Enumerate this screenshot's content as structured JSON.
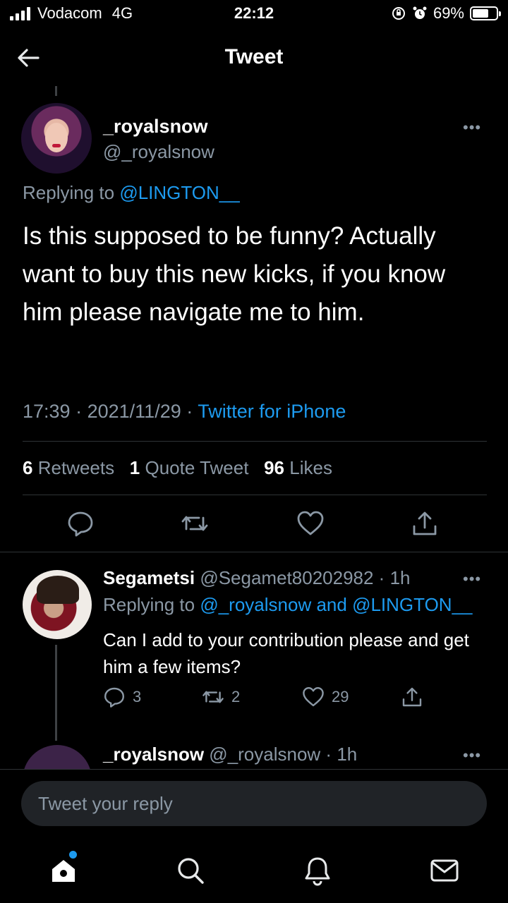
{
  "status_bar": {
    "carrier": "Vodacom",
    "network": "4G",
    "time": "22:12",
    "battery_percent": "69%",
    "battery_level": 0.69
  },
  "header": {
    "title": "Tweet",
    "back_icon": "arrow-left-icon"
  },
  "main_tweet": {
    "display_name": "_royalsnow",
    "handle": "@_royalsnow",
    "replying_prefix": "Replying to",
    "replying_to": "@LINGTON__",
    "text": "Is this supposed to be funny? Actually want to buy this new kicks, if you know him please navigate me to him.",
    "time": "17:39",
    "date": "2021/11/29",
    "source": "Twitter for iPhone",
    "retweets_count": "6",
    "retweets_label": "Retweets",
    "quote_count": "1",
    "quote_label": "Quote Tweet",
    "likes_count": "96",
    "likes_label": "Likes",
    "more_icon": "more-dots-icon"
  },
  "replies": [
    {
      "display_name": "Segametsi",
      "handle": "@Segamet80202982",
      "age": "1h",
      "replying_prefix": "Replying to",
      "replying_to_1": "@_royalsnow",
      "replying_and": "and",
      "replying_to_2": "@LINGTON__",
      "text": "Can I add to your contribution please and get him a few items?",
      "reply_count": "3",
      "retweet_count": "2",
      "like_count": "29"
    },
    {
      "display_name": "_royalsnow",
      "handle": "@_royalsnow",
      "age": "1h"
    }
  ],
  "reply_bar": {
    "placeholder": "Tweet your reply"
  },
  "tab_bar": {
    "items": [
      "home-icon",
      "search-icon",
      "notifications-icon",
      "messages-icon"
    ]
  },
  "colors": {
    "background": "#000000",
    "accent": "#1d9bf0",
    "muted": "#8b98a5"
  }
}
